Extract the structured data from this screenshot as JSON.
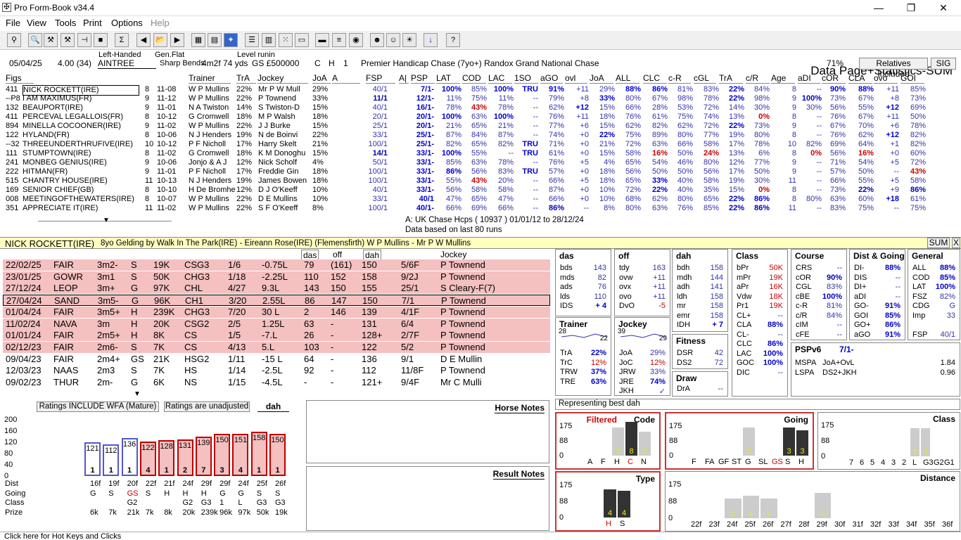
{
  "window": {
    "title": "Pro Form-Book v34.4",
    "minimize": "—",
    "maximize": "❐",
    "close": "✕"
  },
  "menu": [
    "File",
    "View",
    "Tools",
    "Print",
    "Options",
    "Help"
  ],
  "toolbar": {
    "data_page": "Data Page+Statistics-SUM"
  },
  "race": {
    "date": "05/04/25",
    "time": "4.00 (34)",
    "handed_label": "Left-Handed",
    "course": "AINTREE",
    "gen_label": "Gen.Flat",
    "bends": "Sharp Bends",
    "distance": "4m2f 74 yds",
    "level_label": "Level runin",
    "prize": "GS  £500000",
    "c": "C",
    "h": "H",
    "n": "1",
    "race_name": "Premier Handicap Chase (7yo+) Randox Grand National Chase",
    "pct": "71%",
    "relatives_btn": "Relatives Included",
    "sig_btn": "SIG"
  },
  "columns": [
    "Figs",
    "Trainer",
    "TrA",
    "Jockey",
    "JoA",
    "A",
    "FSP",
    "A|",
    "PSP",
    "LAT",
    "COD",
    "LAC",
    "1SO",
    "aGO",
    "ovl",
    "JoA",
    "ALL",
    "CLC",
    "c-R",
    "cGL",
    "TrA",
    "c/R",
    "Age",
    "aDI",
    "cOR",
    "CLA",
    "ovo",
    "GOI"
  ],
  "runners": [
    [
      "411",
      "NICK ROCKETT(IRE)",
      "8",
      "11-08",
      "W P Mullins",
      "22%",
      "Mr P W Mull",
      "29%",
      "40/1",
      "7/1-",
      "100%",
      "85%",
      "100%",
      "TRU",
      "91%",
      "+11",
      "29%",
      "88%",
      "86%",
      "81%",
      "83%",
      "22%",
      "84%",
      "8",
      "--",
      "90%",
      "88%",
      "+11",
      "85%"
    ],
    [
      "--P8",
      "I AM MAXIMUS(FR)",
      "9",
      "11-12",
      "W P Mullins",
      "22%",
      "P Townend",
      "33%",
      "11/1",
      "12/1-",
      "11%",
      "75%",
      "11%",
      "--",
      "79%",
      "+8",
      "33%",
      "80%",
      "67%",
      "98%",
      "78%",
      "22%",
      "98%",
      "9",
      "100%",
      "73%",
      "67%",
      "+8",
      "73%"
    ],
    [
      "132",
      "BEAUPORT(IRE)",
      "9",
      "11-01",
      "N A Twiston",
      "14%",
      "S Twiston-D",
      "15%",
      "40/1",
      "16/1-",
      "78%",
      "43%",
      "78%",
      "--",
      "62%",
      "+12",
      "15%",
      "66%",
      "28%",
      "53%",
      "72%",
      "14%",
      "30%",
      "9",
      "30%",
      "56%",
      "55%",
      "+12",
      "69%"
    ],
    [
      "411",
      "PERCEVAL LEGALLOIS(FR)",
      "8",
      "10-12",
      "G Cromwell",
      "18%",
      "M P Walsh",
      "18%",
      "20/1",
      "20/1-",
      "100%",
      "63%",
      "100%",
      "--",
      "76%",
      "+11",
      "18%",
      "76%",
      "61%",
      "75%",
      "74%",
      "13%",
      "0%",
      "8",
      "--",
      "76%",
      "67%",
      "+11",
      "50%"
    ],
    [
      "894",
      "MINELLA COCOONER(IRE)",
      "9",
      "11-02",
      "W P Mullins",
      "22%",
      "J J Burke",
      "15%",
      "25/1",
      "20/1-",
      "21%",
      "65%",
      "21%",
      "--",
      "77%",
      "+6",
      "15%",
      "62%",
      "82%",
      "62%",
      "72%",
      "22%",
      "73%",
      "9",
      "--",
      "67%",
      "70%",
      "+6",
      "78%"
    ],
    [
      "122",
      "HYLAND(FR)",
      "8",
      "10-06",
      "N J Henders",
      "19%",
      "N de Boinvi",
      "22%",
      "33/1",
      "25/1-",
      "87%",
      "84%",
      "87%",
      "--",
      "74%",
      "+0",
      "22%",
      "75%",
      "89%",
      "80%",
      "77%",
      "19%",
      "80%",
      "8",
      "--",
      "76%",
      "62%",
      "+12",
      "82%"
    ],
    [
      "--32",
      "THREEUNDERTHRUFIVE(IRE)",
      "10",
      "10-12",
      "P F Nicholl",
      "17%",
      "Harry Skelt",
      "21%",
      "100/1",
      "25/1-",
      "82%",
      "65%",
      "82%",
      "TRU",
      "71%",
      "+0",
      "21%",
      "72%",
      "63%",
      "66%",
      "58%",
      "17%",
      "78%",
      "10",
      "82%",
      "69%",
      "64%",
      "+1",
      "82%"
    ],
    [
      "111",
      "STUMPTOWN(IRE)",
      "8",
      "11-02",
      "G Cromwell",
      "18%",
      "K M Donoghu",
      "15%",
      "14/1",
      "33/1-",
      "100%",
      "55%",
      "--",
      "TRU",
      "61%",
      "+0",
      "15%",
      "58%",
      "16%",
      "50%",
      "24%",
      "13%",
      "6%",
      "8",
      "0%",
      "56%",
      "16%",
      "+0",
      "60%"
    ],
    [
      "241",
      "MONBEG GENIUS(IRE)",
      "9",
      "10-06",
      "Jonjo & A J",
      "12%",
      "Nick Scholf",
      "4%",
      "50/1",
      "33/1-",
      "85%",
      "63%",
      "78%",
      "--",
      "76%",
      "+5",
      "4%",
      "65%",
      "54%",
      "46%",
      "80%",
      "12%",
      "77%",
      "9",
      "--",
      "71%",
      "54%",
      "+5",
      "72%"
    ],
    [
      "222",
      "HITMAN(FR)",
      "9",
      "11-01",
      "P F Nicholl",
      "17%",
      "Freddie Gin",
      "18%",
      "100/1",
      "33/1-",
      "86%",
      "56%",
      "83%",
      "TRU",
      "57%",
      "+0",
      "18%",
      "56%",
      "50%",
      "50%",
      "56%",
      "17%",
      "50%",
      "9",
      "--",
      "57%",
      "50%",
      "--",
      "43%"
    ],
    [
      "515",
      "CHANTRY HOUSE(IRE)",
      "11",
      "10-13",
      "N J Henders",
      "19%",
      "James Bowen",
      "18%",
      "100/1",
      "33/1-",
      "55%",
      "43%",
      "20%",
      "--",
      "66%",
      "+5",
      "18%",
      "65%",
      "33%",
      "40%",
      "58%",
      "19%",
      "30%",
      "11",
      "--",
      "66%",
      "55%",
      "+5",
      "58%"
    ],
    [
      "169",
      "SENIOR CHIEF(GB)",
      "8",
      "10-10",
      "H De Bromhe",
      "12%",
      "D J O'Keeff",
      "10%",
      "40/1",
      "33/1-",
      "56%",
      "58%",
      "58%",
      "--",
      "87%",
      "+0",
      "10%",
      "72%",
      "22%",
      "40%",
      "35%",
      "15%",
      "0%",
      "8",
      "--",
      "73%",
      "22%",
      "+9",
      "86%"
    ],
    [
      "008",
      "MEETINGOFTHEWATERS(IRE)",
      "8",
      "10-07",
      "W P Mullins",
      "22%",
      "D E Mullins",
      "10%",
      "33/1",
      "40/1",
      "47%",
      "65%",
      "47%",
      "--",
      "66%",
      "+0",
      "10%",
      "68%",
      "62%",
      "80%",
      "65%",
      "22%",
      "86%",
      "8",
      "80%",
      "63%",
      "60%",
      "+18",
      "61%"
    ],
    [
      "351",
      "APPRECIATE IT(IRE)",
      "11",
      "11-02",
      "W P Mullins",
      "22%",
      "S F O'Keeff",
      "8%",
      "100/1",
      "40/1-",
      "66%",
      "69%",
      "66%",
      "--",
      "86%",
      "--",
      "8%",
      "80%",
      "63%",
      "76%",
      "85%",
      "22%",
      "86%",
      "11",
      "--",
      "83%",
      "75%",
      "--",
      "75%"
    ]
  ],
  "list_footer": {
    "line1": "A: UK Chase Hcps ( 10937 )   01/01/12 to 28/12/24",
    "line2": "Data based on last 80 runs"
  },
  "horse": {
    "name": "NICK ROCKETT(IRE)",
    "breeding": "8yo Gelding by Walk In The Park(IRE) - Eireann Rose(IRE) (Flemensfirth)    W P Mullins  -  Mr P W Mullins",
    "sum_btn": "SUM",
    "close_btn": "X"
  },
  "form_headers": {
    "das": "das",
    "off": "off",
    "dah": "dah",
    "jockey": "Jockey"
  },
  "form": [
    {
      "date": "22/02/25",
      "course": "FAIR",
      "dist": "3m2-",
      "going": "S",
      "prize": "19K",
      "type": "CSG3",
      "pos": "1/6",
      "btn": "-0.75L",
      "das": "79",
      "off": "(161)",
      "dah": "150",
      "sp": "5/6F",
      "jockey": "P Townend",
      "pink": true
    },
    {
      "date": "23/01/25",
      "course": "GOWR",
      "dist": "3m1",
      "going": "S",
      "prize": "50K",
      "type": "CHG3",
      "pos": "1/18",
      "btn": "-2.25L",
      "das": "110",
      "off": "152",
      "dah": "158",
      "sp": "9/2J",
      "jockey": "P Townend",
      "pink": true
    },
    {
      "date": "27/12/24",
      "course": "LEOP",
      "dist": "3m+",
      "going": "G",
      "prize": "97K",
      "type": "CHL",
      "pos": "4/27",
      "btn": "9.3L",
      "das": "143",
      "off": "150",
      "dah": "155",
      "sp": "25/1",
      "jockey": "S Cleary-F(7)",
      "pink": true
    },
    {
      "date": "27/04/24",
      "course": "SAND",
      "dist": "3m5-",
      "going": "G",
      "prize": "96K",
      "type": "CH1",
      "pos": "3/20",
      "btn": "2.55L",
      "das": "86",
      "off": "147",
      "dah": "150",
      "sp": "7/1",
      "jockey": "P Townend",
      "pink": true,
      "sel": true
    },
    {
      "date": "01/04/24",
      "course": "FAIR",
      "dist": "3m5+",
      "going": "H",
      "prize": "239K",
      "type": "CHG3",
      "pos": "7/20",
      "btn": "30 L",
      "das": "2",
      "off": "146",
      "dah": "139",
      "sp": "4/1F",
      "jockey": "P Townend",
      "pink": true
    },
    {
      "date": "11/02/24",
      "course": "NAVA",
      "dist": "3m",
      "going": "H",
      "prize": "20K",
      "type": "CSG2",
      "pos": "2/5",
      "btn": "1.25L",
      "das": "63",
      "off": "-",
      "dah": "131",
      "sp": "6/4",
      "jockey": "P Townend",
      "pink": true
    },
    {
      "date": "01/01/24",
      "course": "FAIR",
      "dist": "2m5+",
      "going": "H",
      "prize": "8K",
      "type": "CS",
      "pos": "1/5",
      "btn": "-7.L",
      "das": "26",
      "off": "-",
      "dah": "128+",
      "sp": "2/7F",
      "jockey": "P Townend",
      "pink": true
    },
    {
      "date": "02/12/23",
      "course": "FAIR",
      "dist": "2m6-",
      "going": "S",
      "prize": "7K",
      "type": "CS",
      "pos": "4/13",
      "btn": "5.L",
      "das": "103",
      "off": "-",
      "dah": "122",
      "sp": "5/2",
      "jockey": "P Townend",
      "pink": true
    },
    {
      "date": "09/04/23",
      "course": "FAIR",
      "dist": "2m4+",
      "going": "GS",
      "prize": "21K",
      "type": "HSG2",
      "pos": "1/11",
      "btn": "-15 L",
      "das": "64",
      "off": "-",
      "dah": "136",
      "sp": "9/1",
      "jockey": "D E Mullin",
      "pink": false
    },
    {
      "date": "12/03/23",
      "course": "NAAS",
      "dist": "2m3",
      "going": "S",
      "prize": "7K",
      "type": "HS",
      "pos": "1/14",
      "btn": "-2.5L",
      "das": "92",
      "off": "-",
      "dah": "112",
      "sp": "11/8F",
      "jockey": "P Townend",
      "pink": false
    },
    {
      "date": "09/02/23",
      "course": "THUR",
      "dist": "2m-",
      "going": "G",
      "prize": "6K",
      "type": "NS",
      "pos": "1/15",
      "btn": "-4.5L",
      "das": "-",
      "off": "-",
      "dah": "121+",
      "sp": "9/4F",
      "jockey": "Mr C Mulli",
      "pink": false
    }
  ],
  "stats": {
    "das": {
      "title": "das",
      "rows": [
        [
          "bds",
          "143"
        ],
        [
          "mds",
          "82"
        ],
        [
          "ads",
          "76"
        ],
        [
          "lds",
          "110"
        ],
        [
          "IDS",
          "+ 4"
        ]
      ]
    },
    "off": {
      "title": "off",
      "rows": [
        [
          "tdy",
          "163"
        ],
        [
          "ovw",
          "+11"
        ],
        [
          "ovx",
          "+11"
        ],
        [
          "ovo",
          "+11"
        ],
        [
          "DvO",
          "-5"
        ]
      ]
    },
    "dah": {
      "title": "dah",
      "rows": [
        [
          "bdh",
          "158"
        ],
        [
          "mdh",
          "144"
        ],
        [
          "adh",
          "141"
        ],
        [
          "ldh",
          "158"
        ],
        [
          "mr",
          "158"
        ],
        [
          "emr",
          "158"
        ],
        [
          "IDH",
          "+ 7"
        ]
      ]
    },
    "class": {
      "title": "Class",
      "rows": [
        [
          "bPr",
          "50K"
        ],
        [
          "mPr",
          "19K"
        ],
        [
          "aPr",
          "16K"
        ],
        [
          "Vdw",
          "18K"
        ],
        [
          "Pr1",
          "19K"
        ],
        [
          "CL+",
          "--"
        ],
        [
          "CLA",
          "88%"
        ],
        [
          "CL-",
          "--"
        ],
        [
          "CLC",
          "86%"
        ],
        [
          "LAC",
          "100%"
        ],
        [
          "GOC",
          "100%"
        ],
        [
          "DIC",
          "--"
        ]
      ]
    },
    "course": {
      "title": "Course",
      "rows": [
        [
          "CRS",
          "--"
        ],
        [
          "cOR",
          "90%"
        ],
        [
          "CGL",
          "83%"
        ],
        [
          "cBE",
          "100%"
        ],
        [
          "c-R",
          "81%"
        ],
        [
          "c/R",
          "84%"
        ],
        [
          "cIM",
          "--"
        ],
        [
          "cFE",
          "--"
        ]
      ]
    },
    "distgoing": {
      "title": "Dist & Going",
      "rows": [
        [
          "DI-",
          "88%"
        ],
        [
          "DIS",
          "--"
        ],
        [
          "DI+",
          "--"
        ],
        [
          "aDI",
          "--"
        ],
        [
          "GO-",
          "91%"
        ],
        [
          "GOI",
          "85%"
        ],
        [
          "GO+",
          "86%"
        ],
        [
          "aGO",
          "91%"
        ]
      ]
    },
    "general": {
      "title": "General",
      "rows": [
        [
          "ALL",
          "88%"
        ],
        [
          "COD",
          "85%"
        ],
        [
          "LAT",
          "100%"
        ],
        [
          "FSZ",
          "82%"
        ],
        [
          "CDG",
          "G"
        ],
        [
          "Imp",
          "33"
        ],
        [
          "",
          ""
        ],
        [
          "FSP",
          "40/1"
        ]
      ]
    },
    "trainer": {
      "title": "Trainer",
      "spark_left": "28",
      "spark_right": "22",
      "rows": [
        [
          "TrA",
          "22%"
        ],
        [
          "TrC",
          "12%"
        ],
        [
          "TRW",
          "37%"
        ],
        [
          "TRE",
          "63%"
        ]
      ]
    },
    "jockey": {
      "title": "Jockey",
      "spark_left": "39",
      "spark_right": "29",
      "rows": [
        [
          "JoA",
          "29%"
        ],
        [
          "JoC",
          "12%"
        ],
        [
          "JRW",
          "33%"
        ],
        [
          "JRE",
          "74%"
        ],
        [
          "JKH",
          "✓"
        ]
      ]
    },
    "fitness": {
      "title": "Fitness",
      "rows": [
        [
          "DSR",
          "42"
        ],
        [
          "DS2",
          "72"
        ]
      ]
    },
    "draw": {
      "title": "Draw",
      "rows": [
        [
          "DrA",
          "--"
        ]
      ]
    },
    "pspv6": {
      "title": "PSPv6",
      "value": "7/1-",
      "rows": [
        [
          "MSPA",
          "JoA+OvL",
          "1.84"
        ],
        [
          "LSPA",
          "DS2+JKH",
          "0.96"
        ]
      ]
    }
  },
  "ratings": {
    "btn1": "Ratings INCLUDE WFA (Mature)",
    "btn2": "Ratings are unadjusted",
    "btn3": "dah",
    "y_ticks": [
      "200",
      "160",
      "120",
      "80",
      "40",
      "0"
    ],
    "bars": [
      {
        "v": 121,
        "pos": "1",
        "blue": true
      },
      {
        "v": 112,
        "pos": "1",
        "blue": true
      },
      {
        "v": 136,
        "pos": "1",
        "blue": true
      },
      {
        "v": 122,
        "pos": "4"
      },
      {
        "v": 128,
        "pos": "1"
      },
      {
        "v": 131,
        "pos": "2"
      },
      {
        "v": 139,
        "pos": "7"
      },
      {
        "v": 150,
        "pos": "3"
      },
      {
        "v": 151,
        "pos": "4"
      },
      {
        "v": 158,
        "pos": "1"
      },
      {
        "v": 150,
        "pos": "1"
      }
    ],
    "row_labels": [
      "Dist",
      "Going",
      "Class",
      "Prize"
    ],
    "dist": [
      "16f",
      "19f",
      "20f",
      "22f",
      "21f",
      "24f",
      "29f",
      "29f",
      "24f",
      "25f",
      "26f"
    ],
    "going": [
      "G",
      "S",
      "GS",
      "S",
      "H",
      "H",
      "H",
      "G",
      "G",
      "S",
      "S"
    ],
    "class": [
      "",
      "",
      "G2",
      "",
      "",
      "G2",
      "G3",
      "1",
      "L",
      "G3",
      "G3"
    ],
    "prize": [
      "6k",
      "7k",
      "21k",
      "7k",
      "8k",
      "20k",
      "239k",
      "96k",
      "97k",
      "50k",
      "19k"
    ]
  },
  "notes": {
    "horse": "Horse Notes",
    "result": "Result Notes"
  },
  "best": {
    "title": "Representing best dah",
    "filtered": {
      "title": "Filtered",
      "code": "Code",
      "cats": [
        "A",
        "F",
        "H",
        "C",
        "N"
      ],
      "vals": [
        0,
        0,
        2,
        8,
        2
      ]
    },
    "going": {
      "title": "Going",
      "cats": [
        "F",
        "FA",
        "GF",
        "ST",
        "G",
        "SL",
        "GS",
        "S",
        "H"
      ],
      "vals": [
        0,
        0,
        0,
        0,
        2,
        0,
        0,
        3,
        3
      ]
    },
    "class": {
      "title": "Class",
      "cats": [
        "7",
        "6",
        "5",
        "4",
        "3",
        "2",
        "L",
        "G3",
        "G2",
        "G1"
      ],
      "vals": [
        0,
        0,
        0,
        0,
        0,
        0,
        2,
        3,
        0,
        0
      ]
    },
    "type": {
      "title": "Type",
      "cats": [
        "H",
        "S"
      ],
      "vals": [
        4,
        4
      ]
    },
    "distance": {
      "title": "Distance",
      "cats": [
        "22f",
        "23f",
        "24f",
        "25f",
        "26f",
        "27f",
        "28f",
        "29f",
        "30f",
        "31f",
        "32f",
        "33f",
        "34f",
        "35f",
        "36f"
      ],
      "vals": [
        0,
        0,
        2,
        1,
        1,
        0,
        0,
        2,
        0,
        0,
        0,
        0,
        0,
        0,
        0
      ]
    },
    "y_ticks": [
      "175",
      "88",
      "0"
    ]
  },
  "status": "Click here for Hot Keys and Clicks"
}
